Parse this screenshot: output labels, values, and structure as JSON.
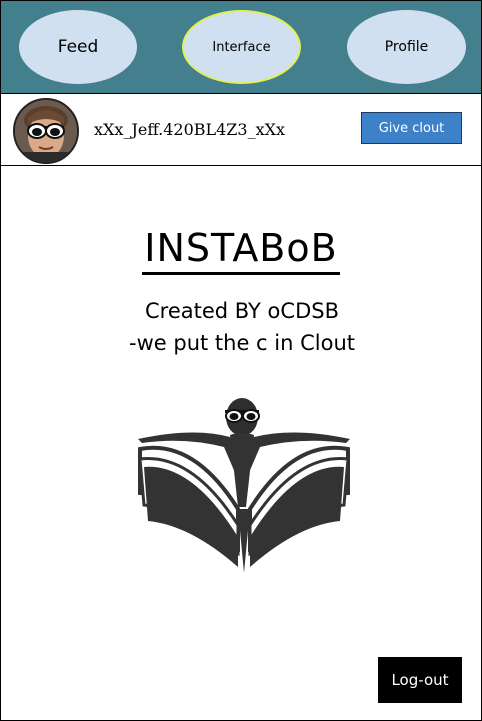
{
  "nav": {
    "feed_label": "Feed",
    "interface_label": "Interface",
    "profile_label": "Profile"
  },
  "profile": {
    "username": "xXx_Jeff.420BL4Z3_xXx",
    "give_clout_label": "Give clout"
  },
  "main": {
    "title": "INSTABoB",
    "subtitle_line1": "Created BY oCDSB",
    "subtitle_line2": "-we put the c in Clout"
  },
  "footer": {
    "logout_label": "Log-out"
  },
  "colors": {
    "nav_bg": "#437f8c",
    "nav_pill": "#d1e0f0",
    "active_pill_border": "#e0f055",
    "give_button": "#3d82c9",
    "logout_button": "#000000"
  },
  "icons": {
    "avatar": "user-avatar-with-sunglasses",
    "logo": "open-book-with-person-logo"
  }
}
